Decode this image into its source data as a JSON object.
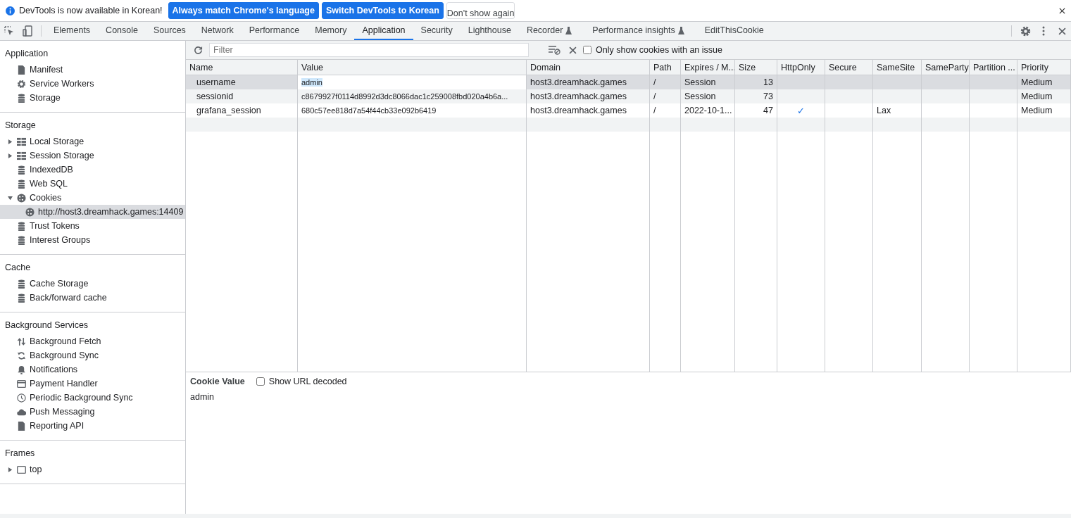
{
  "infobar": {
    "message": "DevTools is now available in Korean!",
    "buttons": [
      {
        "label": "Always match Chrome's language",
        "kind": "primary"
      },
      {
        "label": "Switch DevTools to Korean",
        "kind": "primary"
      },
      {
        "label": "Don't show again",
        "kind": "secondary"
      }
    ]
  },
  "tabs": [
    {
      "label": "Elements",
      "selected": false,
      "experimental": false
    },
    {
      "label": "Console",
      "selected": false,
      "experimental": false
    },
    {
      "label": "Sources",
      "selected": false,
      "experimental": false
    },
    {
      "label": "Network",
      "selected": false,
      "experimental": false
    },
    {
      "label": "Performance",
      "selected": false,
      "experimental": false
    },
    {
      "label": "Memory",
      "selected": false,
      "experimental": false
    },
    {
      "label": "Application",
      "selected": true,
      "experimental": false
    },
    {
      "label": "Security",
      "selected": false,
      "experimental": false
    },
    {
      "label": "Lighthouse",
      "selected": false,
      "experimental": false
    },
    {
      "label": "Recorder",
      "selected": false,
      "experimental": true
    },
    {
      "label": "Performance insights",
      "selected": false,
      "experimental": true
    },
    {
      "label": "EditThisCookie",
      "selected": false,
      "experimental": false
    }
  ],
  "sidebar": [
    {
      "title": "Application",
      "items": [
        {
          "label": "Manifest",
          "kind": "document",
          "selected": false
        },
        {
          "label": "Service Workers",
          "kind": "gear",
          "selected": false
        },
        {
          "label": "Storage",
          "kind": "database",
          "selected": false
        }
      ]
    },
    {
      "title": "Storage",
      "items": [
        {
          "label": "Local Storage",
          "kind": "grid",
          "selected": false,
          "expanded": false
        },
        {
          "label": "Session Storage",
          "kind": "grid",
          "selected": false,
          "expanded": false
        },
        {
          "label": "IndexedDB",
          "kind": "database",
          "selected": false
        },
        {
          "label": "Web SQL",
          "kind": "database",
          "selected": false
        },
        {
          "label": "Cookies",
          "kind": "cookie",
          "selected": false,
          "expanded": true,
          "children": [
            {
              "label": "http://host3.dreamhack.games:14409",
              "kind": "cookie",
              "selected": true
            }
          ]
        },
        {
          "label": "Trust Tokens",
          "kind": "database",
          "selected": false
        },
        {
          "label": "Interest Groups",
          "kind": "database",
          "selected": false
        }
      ]
    },
    {
      "title": "Cache",
      "items": [
        {
          "label": "Cache Storage",
          "kind": "database",
          "selected": false
        },
        {
          "label": "Back/forward cache",
          "kind": "database",
          "selected": false
        }
      ]
    },
    {
      "title": "Background Services",
      "items": [
        {
          "label": "Background Fetch",
          "kind": "arrows",
          "selected": false
        },
        {
          "label": "Background Sync",
          "kind": "sync",
          "selected": false
        },
        {
          "label": "Notifications",
          "kind": "bell",
          "selected": false
        },
        {
          "label": "Payment Handler",
          "kind": "card",
          "selected": false
        },
        {
          "label": "Periodic Background Sync",
          "kind": "clock",
          "selected": false
        },
        {
          "label": "Push Messaging",
          "kind": "cloud",
          "selected": false
        },
        {
          "label": "Reporting API",
          "kind": "document",
          "selected": false
        }
      ]
    },
    {
      "title": "Frames",
      "items": [
        {
          "label": "top",
          "kind": "frame",
          "selected": false,
          "expanded": false
        }
      ]
    }
  ],
  "toolbar": {
    "filter_placeholder": "Filter",
    "issue_checkbox": {
      "label": "Only show cookies with an issue",
      "checked": false
    }
  },
  "table": {
    "columns": [
      "Name",
      "Value",
      "Domain",
      "Path",
      "Expires / M...",
      "Size",
      "HttpOnly",
      "Secure",
      "SameSite",
      "SameParty",
      "Partition ...",
      "Priority"
    ],
    "rows": [
      {
        "selected": true,
        "editing": true,
        "cells": [
          "username",
          "admin",
          "host3.dreamhack.games",
          "/",
          "Session",
          "13",
          "",
          "",
          "",
          "",
          "",
          "Medium"
        ]
      },
      {
        "selected": false,
        "editing": false,
        "cells": [
          "sessionid",
          "c8679927f0114d8992d3dc8066dac1c259008fbd020a4b6a...",
          "host3.dreamhack.games",
          "/",
          "Session",
          "73",
          "",
          "",
          "",
          "",
          "",
          "Medium"
        ]
      },
      {
        "selected": false,
        "editing": false,
        "cells": [
          "grafana_session",
          "680c57ee818d7a54f44cb33e092b6419",
          "host3.dreamhack.games",
          "/",
          "2022-10-1...",
          "47",
          "✓",
          "",
          "Lax",
          "",
          "",
          "Medium"
        ]
      }
    ]
  },
  "cookie_value": {
    "title": "Cookie Value",
    "decode_checkbox": {
      "label": "Show URL decoded",
      "checked": false
    },
    "value": "admin"
  }
}
